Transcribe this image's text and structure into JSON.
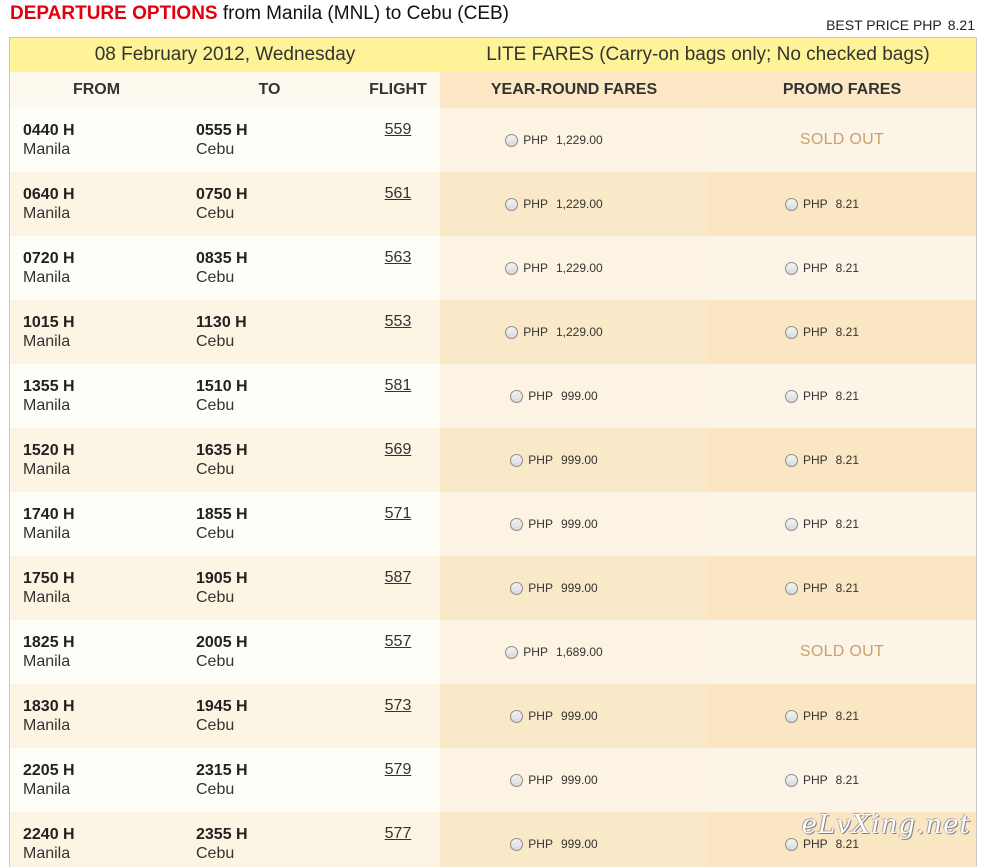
{
  "header": {
    "title_strong": "DEPARTURE OPTIONS",
    "title_rest": "from Manila (MNL) to Cebu (CEB)",
    "best_price_label": "BEST PRICE PHP",
    "best_price_amount": "8.21"
  },
  "date_bar": {
    "date": "08 February 2012, Wednesday",
    "fare_class": "LITE FARES (Carry-on bags only; No checked bags)"
  },
  "columns": {
    "from": "FROM",
    "to": "TO",
    "flight": "FLIGHT",
    "year_round": "YEAR-ROUND FARES",
    "promo": "PROMO FARES"
  },
  "currency": "PHP",
  "flights": [
    {
      "dep": "0440 H",
      "dep_city": "Manila",
      "arr": "0555 H",
      "arr_city": "Cebu",
      "flight": "559",
      "year_round": "1,229.00",
      "promo": "SOLD OUT"
    },
    {
      "dep": "0640 H",
      "dep_city": "Manila",
      "arr": "0750 H",
      "arr_city": "Cebu",
      "flight": "561",
      "year_round": "1,229.00",
      "promo": "8.21"
    },
    {
      "dep": "0720 H",
      "dep_city": "Manila",
      "arr": "0835 H",
      "arr_city": "Cebu",
      "flight": "563",
      "year_round": "1,229.00",
      "promo": "8.21"
    },
    {
      "dep": "1015 H",
      "dep_city": "Manila",
      "arr": "1130 H",
      "arr_city": "Cebu",
      "flight": "553",
      "year_round": "1,229.00",
      "promo": "8.21"
    },
    {
      "dep": "1355 H",
      "dep_city": "Manila",
      "arr": "1510 H",
      "arr_city": "Cebu",
      "flight": "581",
      "year_round": "999.00",
      "promo": "8.21"
    },
    {
      "dep": "1520 H",
      "dep_city": "Manila",
      "arr": "1635 H",
      "arr_city": "Cebu",
      "flight": "569",
      "year_round": "999.00",
      "promo": "8.21"
    },
    {
      "dep": "1740 H",
      "dep_city": "Manila",
      "arr": "1855 H",
      "arr_city": "Cebu",
      "flight": "571",
      "year_round": "999.00",
      "promo": "8.21"
    },
    {
      "dep": "1750 H",
      "dep_city": "Manila",
      "arr": "1905 H",
      "arr_city": "Cebu",
      "flight": "587",
      "year_round": "999.00",
      "promo": "8.21"
    },
    {
      "dep": "1825 H",
      "dep_city": "Manila",
      "arr": "2005 H",
      "arr_city": "Cebu",
      "flight": "557",
      "year_round": "1,689.00",
      "promo": "SOLD OUT"
    },
    {
      "dep": "1830 H",
      "dep_city": "Manila",
      "arr": "1945 H",
      "arr_city": "Cebu",
      "flight": "573",
      "year_round": "999.00",
      "promo": "8.21"
    },
    {
      "dep": "2205 H",
      "dep_city": "Manila",
      "arr": "2315 H",
      "arr_city": "Cebu",
      "flight": "579",
      "year_round": "999.00",
      "promo": "8.21"
    },
    {
      "dep": "2240 H",
      "dep_city": "Manila",
      "arr": "2355 H",
      "arr_city": "Cebu",
      "flight": "577",
      "year_round": "999.00",
      "promo": "8.21"
    }
  ],
  "watermark": "eLvXing.net"
}
